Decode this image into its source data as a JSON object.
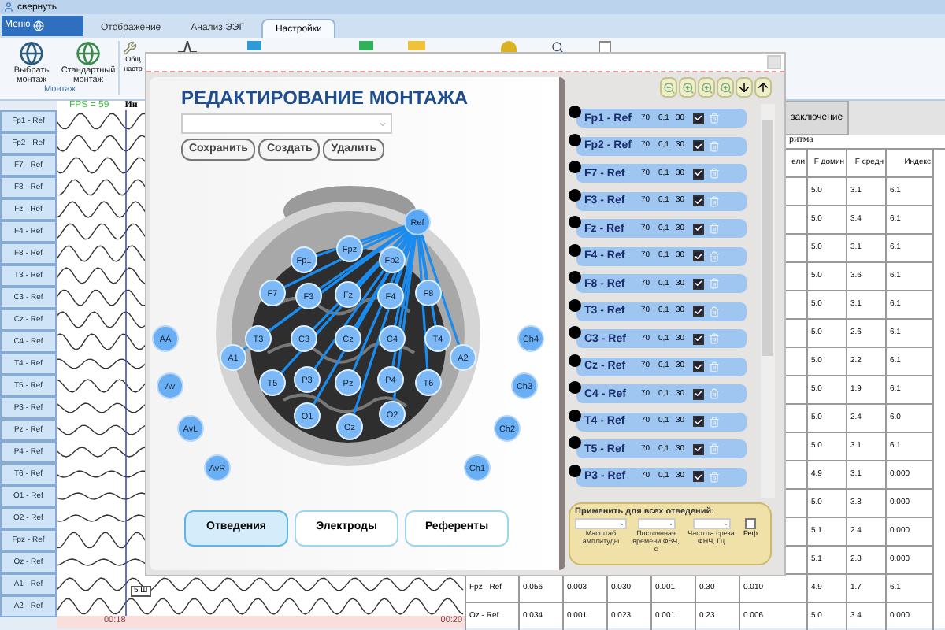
{
  "window": {
    "minimize_label": "свернуть"
  },
  "menu_button": {
    "label": "Меню"
  },
  "tabs": [
    {
      "label": "Отображение",
      "selected": false
    },
    {
      "label": "Анализ ЭЭГ",
      "selected": false
    },
    {
      "label": "Настройки",
      "selected": true
    }
  ],
  "ribbon": {
    "buttons": [
      {
        "label": "Выбрать монтаж"
      },
      {
        "label": "Стандартный монтаж"
      }
    ],
    "group_label": "Монтаж",
    "partial_button": "Общ настр"
  },
  "eeg": {
    "fps": "FPS = 59",
    "header": "Ин",
    "scale_marker": "5 Ш",
    "time_marks": [
      "00:18",
      "00:20"
    ],
    "channels": [
      "Fp1 - Ref",
      "Fp2 - Ref",
      "F7 - Ref",
      "F3 - Ref",
      "Fz - Ref",
      "F4 - Ref",
      "F8 - Ref",
      "T3 - Ref",
      "C3 - Ref",
      "Cz - Ref",
      "C4 - Ref",
      "T4 - Ref",
      "T5 - Ref",
      "P3 - Ref",
      "Pz - Ref",
      "P4 - Ref",
      "T6 - Ref",
      "O1 - Ref",
      "O2 - Ref",
      "Fpz - Ref",
      "Oz - Ref",
      "A1 - Ref",
      "A2 - Ref"
    ]
  },
  "conclusion_button": "заключение",
  "rhythm_title": "ритма",
  "table": {
    "columns": [
      "ели",
      "F домин",
      "F средн",
      "Индекс"
    ],
    "rows": [
      {
        "values": [
          "5.0",
          "3.1",
          "6.1"
        ]
      },
      {
        "values": [
          "5.0",
          "3.4",
          "6.1"
        ]
      },
      {
        "values": [
          "5.0",
          "3.1",
          "6.1"
        ]
      },
      {
        "values": [
          "5.0",
          "3.6",
          "6.1"
        ]
      },
      {
        "values": [
          "5.0",
          "3.1",
          "6.1"
        ]
      },
      {
        "values": [
          "5.0",
          "2.6",
          "6.1"
        ]
      },
      {
        "values": [
          "5.0",
          "2.2",
          "6.1"
        ]
      },
      {
        "values": [
          "5.0",
          "1.9",
          "6.1"
        ]
      },
      {
        "values": [
          "5.0",
          "2.4",
          "6.0"
        ]
      },
      {
        "values": [
          "5.0",
          "3.1",
          "6.1"
        ]
      },
      {
        "values": [
          "4.9",
          "3.1",
          "0.000"
        ]
      },
      {
        "values": [
          "5.0",
          "3.8",
          "0.000"
        ]
      },
      {
        "values": [
          "5.1",
          "2.4",
          "0.000"
        ]
      },
      {
        "values": [
          "5.1",
          "2.8",
          "0.000"
        ]
      },
      {
        "label": "Fpz - Ref",
        "values": [
          "0.056",
          "0.003",
          "0.030",
          "0.001",
          "0.30",
          "0.010",
          "4.9",
          "1.7",
          "6.1"
        ]
      },
      {
        "label": "Oz - Ref",
        "values": [
          "0.034",
          "0.001",
          "0.023",
          "0.001",
          "0.23",
          "0.006",
          "5.0",
          "3.4",
          "0.000"
        ]
      }
    ]
  },
  "dialog": {
    "title": "РЕДАКТИРОВАНИЕ МОНТАЖА",
    "buttons": [
      "Сохранить",
      "Создать",
      "Удалить"
    ],
    "electrodes": [
      {
        "label": "Ref",
        "kind": "reference"
      },
      {
        "label": "Fpz",
        "kind": "lead"
      },
      {
        "label": "Fp1",
        "kind": "lead"
      },
      {
        "label": "Fp2",
        "kind": "lead"
      },
      {
        "label": "F7",
        "kind": "lead"
      },
      {
        "label": "F3",
        "kind": "lead"
      },
      {
        "label": "Fz",
        "kind": "lead"
      },
      {
        "label": "F4",
        "kind": "lead"
      },
      {
        "label": "F8",
        "kind": "lead"
      },
      {
        "label": "T3",
        "kind": "lead"
      },
      {
        "label": "C3",
        "kind": "lead"
      },
      {
        "label": "Cz",
        "kind": "lead"
      },
      {
        "label": "C4",
        "kind": "lead"
      },
      {
        "label": "T4",
        "kind": "lead"
      },
      {
        "label": "A1",
        "kind": "lead"
      },
      {
        "label": "A2",
        "kind": "lead"
      },
      {
        "label": "T5",
        "kind": "lead"
      },
      {
        "label": "P3",
        "kind": "lead"
      },
      {
        "label": "Pz",
        "kind": "lead"
      },
      {
        "label": "P4",
        "kind": "lead"
      },
      {
        "label": "T6",
        "kind": "lead"
      },
      {
        "label": "O1",
        "kind": "lead"
      },
      {
        "label": "Oz",
        "kind": "lead"
      },
      {
        "label": "O2",
        "kind": "lead"
      },
      {
        "label": "AA",
        "kind": "extra"
      },
      {
        "label": "Av",
        "kind": "extra"
      },
      {
        "label": "AvL",
        "kind": "extra"
      },
      {
        "label": "AvR",
        "kind": "extra"
      },
      {
        "label": "Ch4",
        "kind": "extra"
      },
      {
        "label": "Ch3",
        "kind": "extra"
      },
      {
        "label": "Ch2",
        "kind": "extra"
      },
      {
        "label": "Ch1",
        "kind": "extra"
      }
    ],
    "bottom_tabs": [
      {
        "label": "Отведения",
        "selected": true
      },
      {
        "label": "Электроды",
        "selected": false
      },
      {
        "label": "Референты",
        "selected": false
      }
    ],
    "montage": [
      {
        "label": "Fp1 - Ref",
        "scale": "70",
        "time_constant": "0,1",
        "cutoff": "30",
        "checked": true
      },
      {
        "label": "Fp2 - Ref",
        "scale": "70",
        "time_constant": "0,1",
        "cutoff": "30",
        "checked": true
      },
      {
        "label": "F7 - Ref",
        "scale": "70",
        "time_constant": "0,1",
        "cutoff": "30",
        "checked": true
      },
      {
        "label": "F3 - Ref",
        "scale": "70",
        "time_constant": "0,1",
        "cutoff": "30",
        "checked": true
      },
      {
        "label": "Fz - Ref",
        "scale": "70",
        "time_constant": "0,1",
        "cutoff": "30",
        "checked": true
      },
      {
        "label": "F4 - Ref",
        "scale": "70",
        "time_constant": "0,1",
        "cutoff": "30",
        "checked": true
      },
      {
        "label": "F8 - Ref",
        "scale": "70",
        "time_constant": "0,1",
        "cutoff": "30",
        "checked": true
      },
      {
        "label": "T3 - Ref",
        "scale": "70",
        "time_constant": "0,1",
        "cutoff": "30",
        "checked": true
      },
      {
        "label": "C3 - Ref",
        "scale": "70",
        "time_constant": "0,1",
        "cutoff": "30",
        "checked": true
      },
      {
        "label": "Cz - Ref",
        "scale": "70",
        "time_constant": "0,1",
        "cutoff": "30",
        "checked": true
      },
      {
        "label": "C4 - Ref",
        "scale": "70",
        "time_constant": "0,1",
        "cutoff": "30",
        "checked": true
      },
      {
        "label": "T4 - Ref",
        "scale": "70",
        "time_constant": "0,1",
        "cutoff": "30",
        "checked": true
      },
      {
        "label": "T5 - Ref",
        "scale": "70",
        "time_constant": "0,1",
        "cutoff": "30",
        "checked": true
      },
      {
        "label": "P3 - Ref",
        "scale": "70",
        "time_constant": "0,1",
        "cutoff": "30",
        "checked": true
      }
    ],
    "apply_all": {
      "title": "Применить для всех отведений:",
      "fields": [
        "Масштаб амплитуды",
        "Постоянная времени ФВЧ, с",
        "Частота среза ФНЧ, Гц"
      ],
      "ref_checkbox": {
        "label": "Реф",
        "checked": false
      }
    }
  }
}
